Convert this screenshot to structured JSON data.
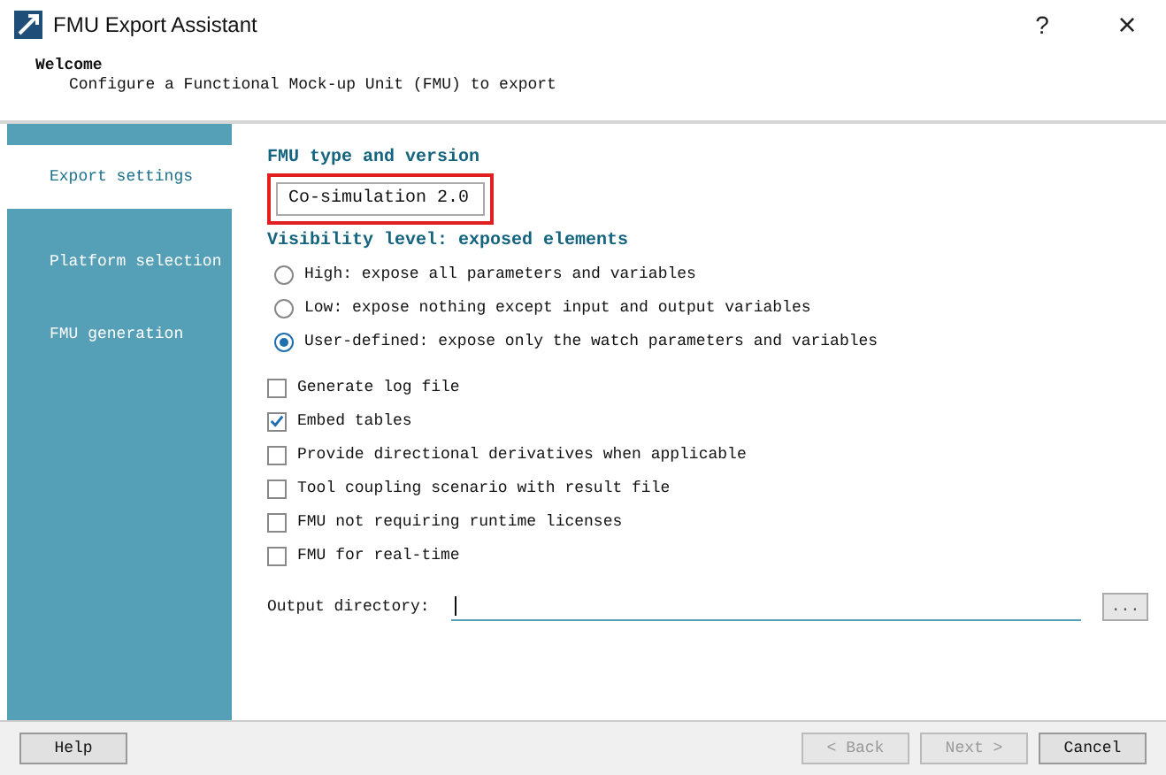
{
  "window": {
    "title": "FMU Export Assistant",
    "help": "?",
    "close": "×"
  },
  "header": {
    "title": "Welcome",
    "subtitle": "Configure a Functional Mock-up Unit (FMU) to export"
  },
  "sidebar": {
    "items": [
      {
        "label": "Export settings",
        "selected": true
      },
      {
        "label": "Platform selection",
        "selected": false
      },
      {
        "label": "FMU generation",
        "selected": false
      }
    ]
  },
  "fmu_type": {
    "heading": "FMU type and version",
    "value": "Co-simulation 2.0",
    "highlighted": true
  },
  "visibility": {
    "heading": "Visibility level: exposed elements",
    "options": [
      {
        "label": "High: expose all parameters and variables",
        "selected": false
      },
      {
        "label": "Low: expose nothing except input and output variables",
        "selected": false
      },
      {
        "label": "User-defined: expose only the watch parameters and variables",
        "selected": true
      }
    ]
  },
  "options": [
    {
      "label": "Generate log file",
      "checked": false
    },
    {
      "label": "Embed tables",
      "checked": true
    },
    {
      "label": "Provide directional derivatives when applicable",
      "checked": false
    },
    {
      "label": "Tool coupling scenario with result file",
      "checked": false
    },
    {
      "label": "FMU not requiring runtime licenses",
      "checked": false
    },
    {
      "label": "FMU for real-time",
      "checked": false
    }
  ],
  "output_directory": {
    "label": "Output directory:",
    "browse": "..."
  },
  "buttons": [
    {
      "label": "Help",
      "disabled": false
    },
    {
      "label": "< Back",
      "disabled": true
    },
    {
      "label": "Next >",
      "disabled": true
    },
    {
      "label": "Cancel",
      "disabled": false
    }
  ]
}
